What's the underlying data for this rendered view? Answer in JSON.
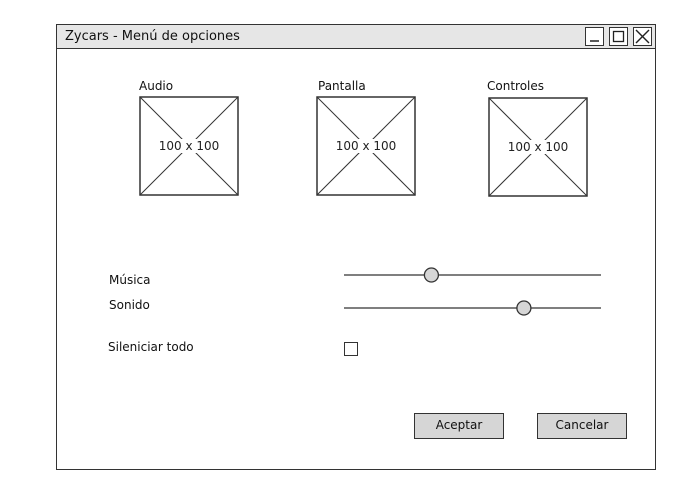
{
  "window": {
    "title": "Zycars - Menú de opciones"
  },
  "categories": [
    {
      "label": "Audio",
      "placeholder": "100 x 100"
    },
    {
      "label": "Pantalla",
      "placeholder": "100 x 100"
    },
    {
      "label": "Controles",
      "placeholder": "100 x 100"
    }
  ],
  "settings": {
    "music_label": "Música",
    "music_value": 0.34,
    "sound_label": "Sonido",
    "sound_value": 0.7,
    "mute_label": "Sileniciar todo",
    "mute_checked": false
  },
  "actions": {
    "accept_label": "Aceptar",
    "cancel_label": "Cancelar"
  }
}
